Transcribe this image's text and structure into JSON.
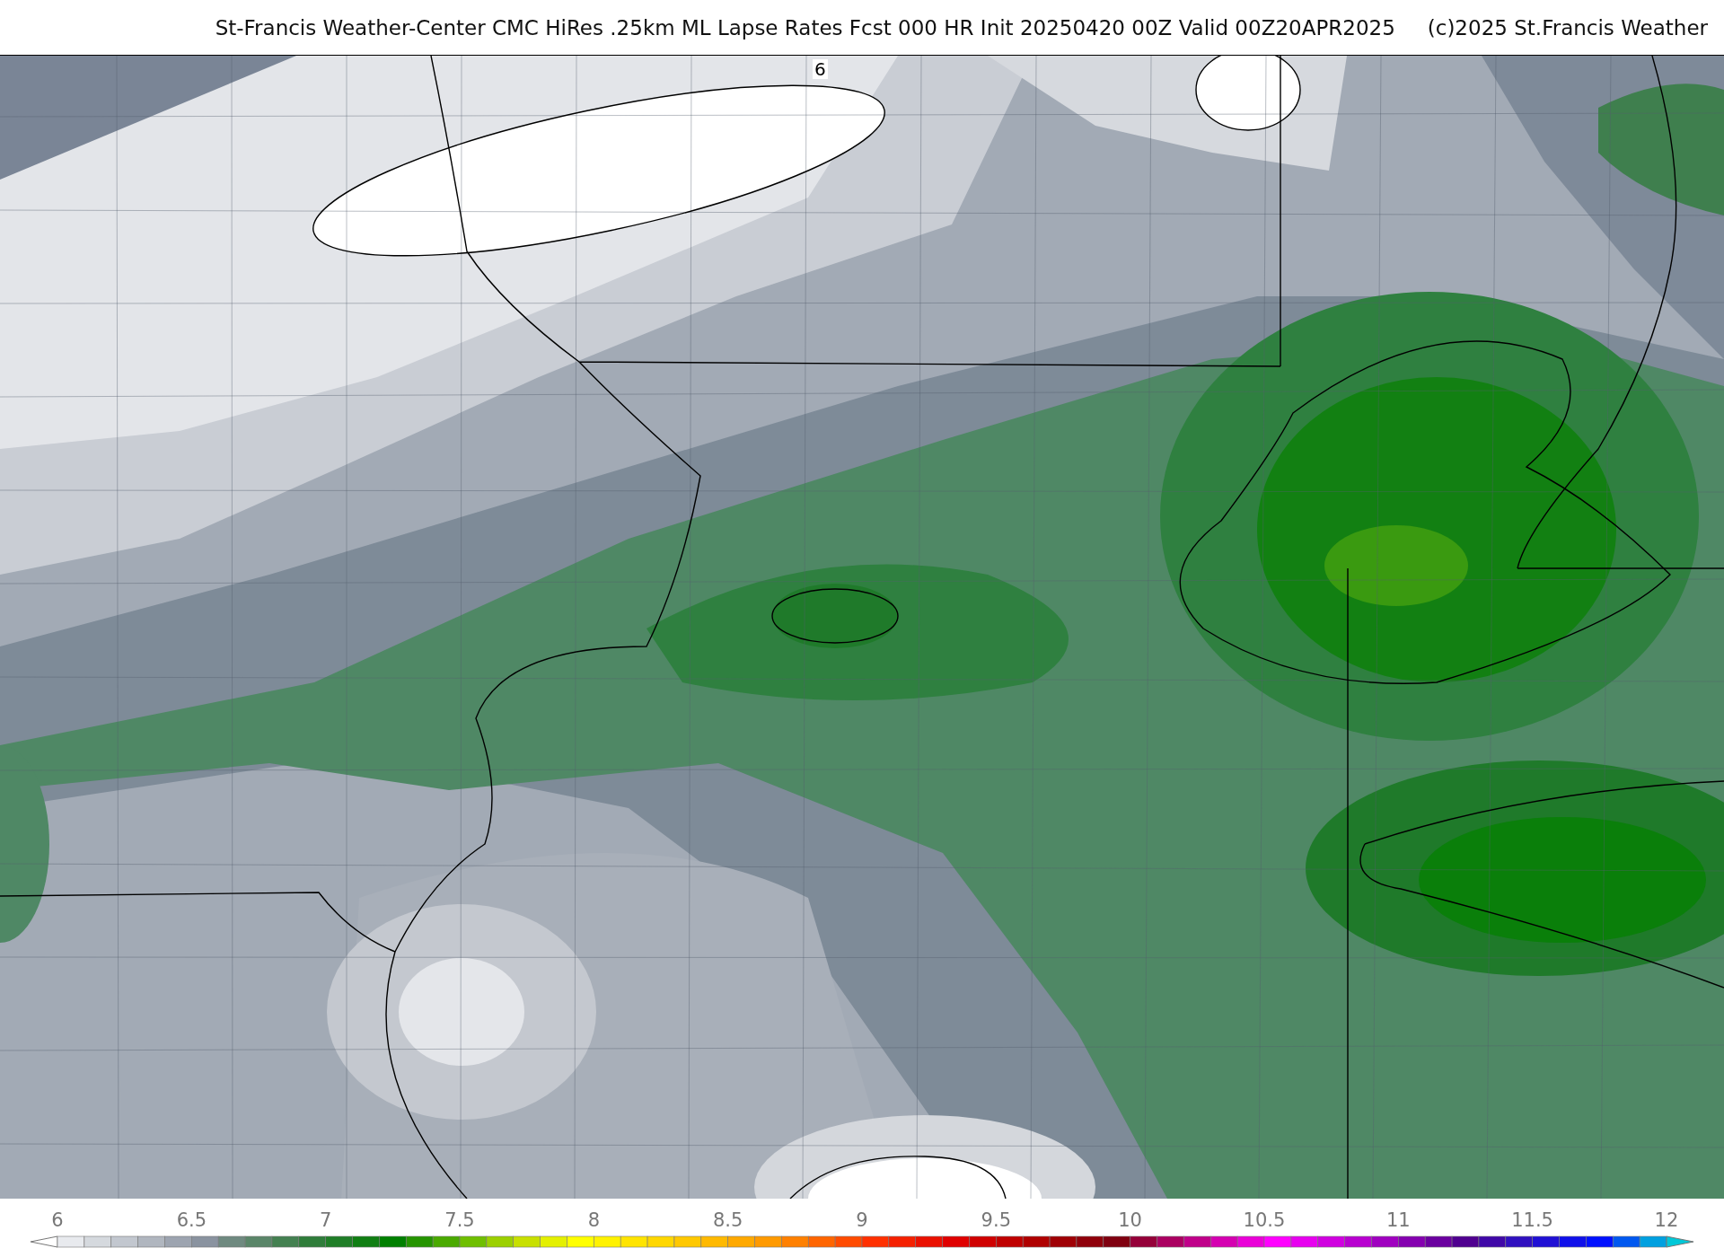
{
  "title": {
    "text": "St-Francis Weather-Center CMC HiRes .25km ML Lapse Rates  Fcst 000 HR Init 20250420 00Z  Valid 00Z20APR2025",
    "credit": "(c)2025 St.Francis Weather"
  },
  "map": {
    "contour_labels": [
      "6"
    ]
  },
  "colorbar": {
    "labels": [
      "6",
      "6.5",
      "7",
      "7.5",
      "8",
      "8.5",
      "9",
      "9.5",
      "10",
      "10.5",
      "11",
      "11.5",
      "12"
    ]
  }
}
